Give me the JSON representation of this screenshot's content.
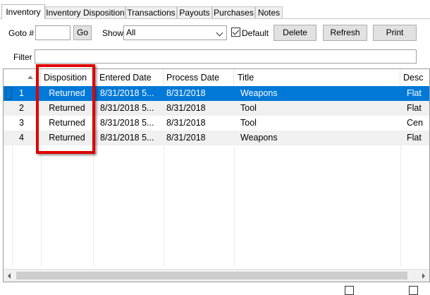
{
  "tabs": [
    {
      "label": "Inventory",
      "active": true
    },
    {
      "label": "Inventory Disposition"
    },
    {
      "label": "Transactions"
    },
    {
      "label": "Payouts"
    },
    {
      "label": "Purchases"
    },
    {
      "label": "Notes"
    }
  ],
  "toolbar": {
    "goto_label": "Goto #",
    "goto_value": "",
    "go_label": "Go",
    "show_label": "Show",
    "show_value": "All",
    "default_label": "Default",
    "default_checked": true,
    "delete_label": "Delete",
    "refresh_label": "Refresh",
    "print_label": "Print"
  },
  "filter": {
    "label": "Filter",
    "value": ""
  },
  "grid": {
    "columns": [
      "",
      "Disposition",
      "Entered Date",
      "Process Date",
      "Title",
      "Desc"
    ],
    "rows": [
      {
        "num": "1",
        "disposition": "Returned",
        "entered": "8/31/2018 5...",
        "process": "8/31/2018",
        "title": "Weapons",
        "desc": "Flat"
      },
      {
        "num": "2",
        "disposition": "Returned",
        "entered": "8/31/2018 5...",
        "process": "8/31/2018",
        "title": "Tool",
        "desc": "Flat"
      },
      {
        "num": "3",
        "disposition": "Returned",
        "entered": "8/31/2018 5...",
        "process": "8/31/2018",
        "title": "Tool",
        "desc": "Cen"
      },
      {
        "num": "4",
        "disposition": "Returned",
        "entered": "8/31/2018 5...",
        "process": "8/31/2018",
        "title": "Weapons",
        "desc": "Flat"
      }
    ]
  },
  "colors": {
    "selection": "#0078d7",
    "highlight": "#e00000"
  }
}
